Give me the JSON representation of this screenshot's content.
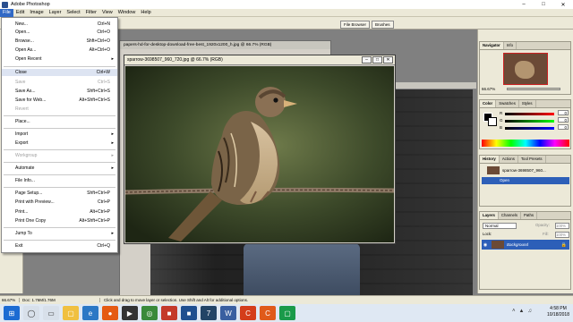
{
  "window": {
    "title": "Adobe Photoshop"
  },
  "menubar": [
    "File",
    "Edit",
    "Image",
    "Layer",
    "Select",
    "Filter",
    "View",
    "Window",
    "Help"
  ],
  "palette_well": [
    "File Browser",
    "Brushes"
  ],
  "bg_doc": {
    "title": "papers-hd-for-desktop-download-free-best_1920x1200_h.jpg @ 66.7% (RGB)"
  },
  "sparrow_doc": {
    "title": "sparrow-3698507_960_720.jpg @ 66.7% (RGB)"
  },
  "file_menu": {
    "items": [
      {
        "label": "New...",
        "shortcut": "Ctrl+N",
        "enabled": true
      },
      {
        "label": "Open...",
        "shortcut": "Ctrl+O",
        "enabled": true
      },
      {
        "label": "Browse...",
        "shortcut": "Shft+Ctrl+O",
        "enabled": true
      },
      {
        "label": "Open As...",
        "shortcut": "Alt+Ctrl+O",
        "enabled": true
      },
      {
        "label": "Open Recent",
        "shortcut": "",
        "enabled": true,
        "submenu": true
      },
      {
        "label": "Close",
        "shortcut": "Ctrl+W",
        "enabled": true,
        "highlight": true
      },
      {
        "label": "Save",
        "shortcut": "Ctrl+S",
        "enabled": false
      },
      {
        "label": "Save As...",
        "shortcut": "Shft+Ctrl+S",
        "enabled": true
      },
      {
        "label": "Save for Web...",
        "shortcut": "Alt+Shft+Ctrl+S",
        "enabled": true
      },
      {
        "label": "Revert",
        "shortcut": "",
        "enabled": false
      },
      {
        "label": "Place...",
        "shortcut": "",
        "enabled": true
      },
      {
        "label": "Import",
        "shortcut": "",
        "enabled": true,
        "submenu": true
      },
      {
        "label": "Export",
        "shortcut": "",
        "enabled": true,
        "submenu": true
      },
      {
        "label": "Workgroup",
        "shortcut": "",
        "enabled": false,
        "submenu": true
      },
      {
        "label": "Automate",
        "shortcut": "",
        "enabled": true,
        "submenu": true
      },
      {
        "label": "File Info...",
        "shortcut": "",
        "enabled": true
      },
      {
        "label": "Page Setup...",
        "shortcut": "Shft+Ctrl+P",
        "enabled": true
      },
      {
        "label": "Print with Preview...",
        "shortcut": "Ctrl+P",
        "enabled": true
      },
      {
        "label": "Print...",
        "shortcut": "Alt+Ctrl+P",
        "enabled": true
      },
      {
        "label": "Print One Copy",
        "shortcut": "Alt+Shft+Ctrl+P",
        "enabled": true
      },
      {
        "label": "Jump To",
        "shortcut": "",
        "enabled": true,
        "submenu": true
      },
      {
        "label": "Exit",
        "shortcut": "Ctrl+Q",
        "enabled": true
      }
    ]
  },
  "navigator": {
    "tabs": [
      "Navigator",
      "Info"
    ],
    "zoom": "66.67%"
  },
  "color": {
    "tabs": [
      "Color",
      "Swatches",
      "Styles"
    ],
    "channels": [
      "R",
      "G",
      "B"
    ],
    "values": [
      "0",
      "0",
      "0"
    ]
  },
  "history": {
    "tabs": [
      "History",
      "Actions",
      "Tool Presets"
    ],
    "items": [
      "sparrow-3698507_960...",
      "Open"
    ]
  },
  "layers": {
    "tabs": [
      "Layers",
      "Channels",
      "Paths"
    ],
    "blend_mode": "Normal",
    "opacity_label": "Opacity:",
    "opacity": "100%",
    "lock_label": "Lock:",
    "fill_label": "Fill:",
    "fill": "100%",
    "layer_name": "Background"
  },
  "status": {
    "zoom": "66.67%",
    "doc": "Doc: 1.76M/1.76M",
    "hint": "Click and drag to move layer or selection. Use Shift and Alt for additional options."
  },
  "taskbar": {
    "time": "4:58 PM",
    "date": "10/18/2018"
  }
}
